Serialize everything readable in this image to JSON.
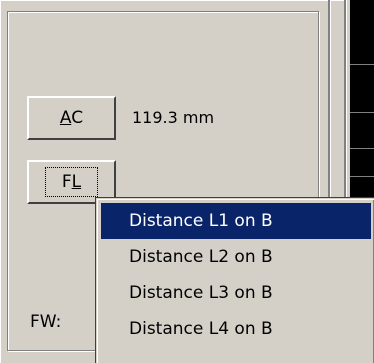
{
  "buttons": {
    "ac": {
      "prefix": "",
      "underline": "A",
      "rest": "C"
    },
    "fl": {
      "prefix": "F",
      "underline": "L",
      "rest": ""
    }
  },
  "measurement": {
    "ac_value": "119.3 mm"
  },
  "fw_label": "FW:",
  "menu": {
    "items": [
      {
        "label": "Distance L1 on B",
        "selected": true
      },
      {
        "label": "Distance L2 on B",
        "selected": false
      },
      {
        "label": "Distance L3 on B",
        "selected": false
      },
      {
        "label": "Distance L4 on B",
        "selected": false
      }
    ]
  },
  "colors": {
    "face": "#d4d0c8",
    "highlight": "#0a246a",
    "highlight_text": "#ffffff",
    "dark_strip": "#000000"
  }
}
